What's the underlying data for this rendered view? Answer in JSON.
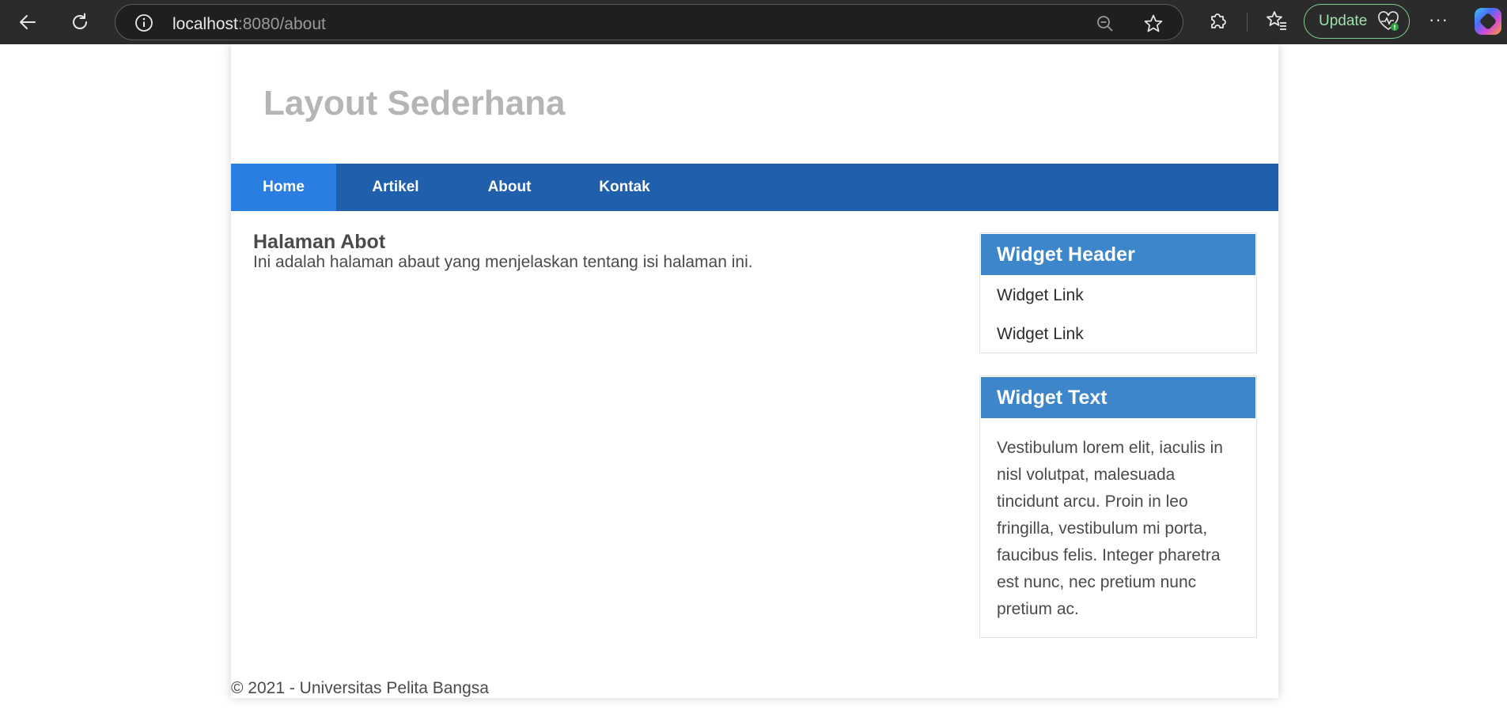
{
  "browser": {
    "address_host": "localhost",
    "address_path": ":8080/about",
    "update_label": "Update",
    "more_label": "···"
  },
  "site": {
    "title": "Layout Sederhana",
    "nav": [
      {
        "label": "Home",
        "active": true
      },
      {
        "label": "Artikel",
        "active": false
      },
      {
        "label": "About",
        "active": false
      },
      {
        "label": "Kontak",
        "active": false
      }
    ],
    "content": {
      "title": "Halaman Abot",
      "text": "Ini adalah halaman abaut yang menjelaskan tentang isi halaman ini."
    },
    "widgets": {
      "links": {
        "header": "Widget Header",
        "items": [
          "Widget Link",
          "Widget Link"
        ]
      },
      "text": {
        "header": "Widget Text",
        "body": "Vestibulum lorem elit, iaculis in nisl volutpat, malesuada tincidunt arcu. Proin in leo fringilla, vestibulum mi porta, faucibus felis. Integer pharetra est nunc, nec pretium nunc pretium ac."
      }
    },
    "footer": "© 2021 - Universitas Pelita Bangsa"
  },
  "colors": {
    "nav_bg": "#1f5fab",
    "nav_active": "#2a7de1",
    "widget_header": "#3d86c9",
    "title_gray": "#b5b5b5"
  }
}
